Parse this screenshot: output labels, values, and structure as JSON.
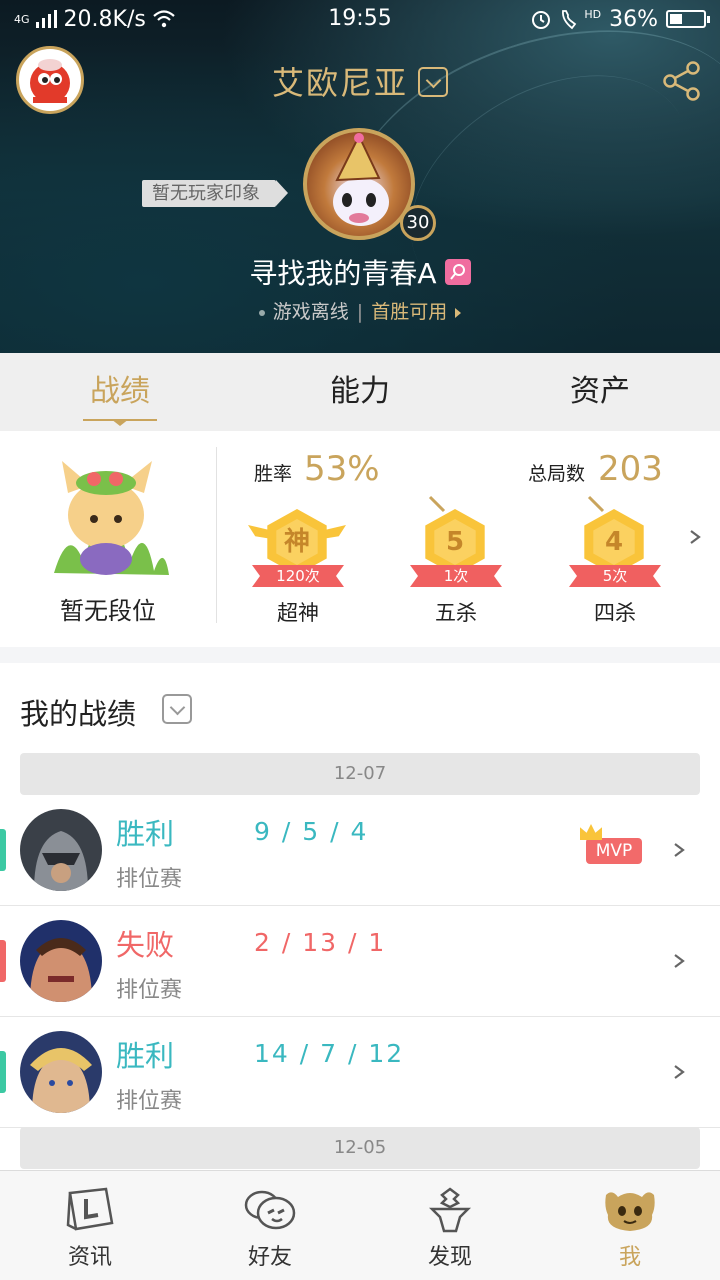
{
  "status_bar": {
    "network": "4G",
    "speed": "20.8K/s",
    "time": "19:55",
    "hd": "HD",
    "battery": "36%",
    "battery_level": 0.36
  },
  "header": {
    "server_name": "艾欧尼亚",
    "impression": "暂无玩家印象",
    "level": "30",
    "player_name": "寻找我的青春A",
    "online_status": "游戏离线",
    "first_win": "首胜可用"
  },
  "tabs": [
    {
      "label": "战绩",
      "active": true
    },
    {
      "label": "能力",
      "active": false
    },
    {
      "label": "资产",
      "active": false
    }
  ],
  "stats": {
    "rank": "暂无段位",
    "win_rate_label": "胜率",
    "win_rate": "53%",
    "total_label": "总局数",
    "total_games": "203",
    "badges": [
      {
        "icon_text": "神",
        "count": "120次",
        "name": "超神"
      },
      {
        "icon_text": "5",
        "count": "1次",
        "name": "五杀"
      },
      {
        "icon_text": "4",
        "count": "5次",
        "name": "四杀"
      }
    ]
  },
  "records": {
    "title": "我的战绩",
    "dates": [
      "12-07",
      "12-05"
    ],
    "matches": [
      {
        "result": "胜利",
        "kda": "9 / 5 / 4",
        "mode": "排位赛",
        "mvp": "MVP",
        "win": true
      },
      {
        "result": "失败",
        "kda": "2 / 13 / 1",
        "mode": "排位赛",
        "win": false
      },
      {
        "result": "胜利",
        "kda": "14 / 7 / 12",
        "mode": "排位赛",
        "win": true
      }
    ]
  },
  "nav": [
    {
      "label": "资讯",
      "icon": "news-book-icon"
    },
    {
      "label": "好友",
      "icon": "friends-chat-icon"
    },
    {
      "label": "发现",
      "icon": "discover-figure-icon"
    },
    {
      "label": "我",
      "icon": "me-poro-icon",
      "active": true
    }
  ],
  "colors": {
    "gold": "#c9a45c",
    "win": "#3ab8c0",
    "loss": "#f06767",
    "win_stripe": "#3cc9a3",
    "loss_stripe": "#f06767"
  }
}
